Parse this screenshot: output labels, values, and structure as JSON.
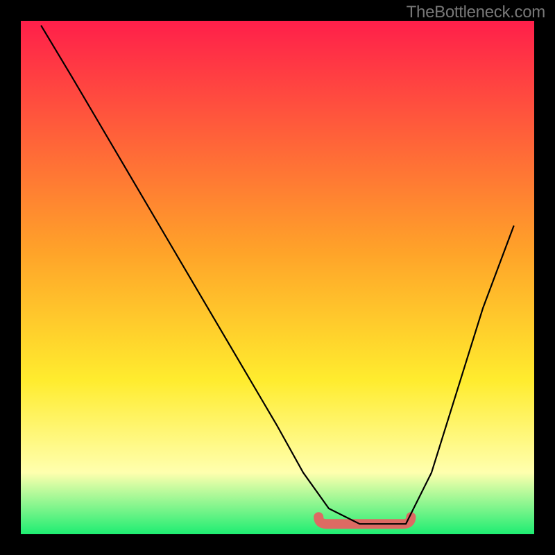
{
  "watermark": "TheBottleneck.com",
  "colors": {
    "red": "#ff1f4a",
    "orange": "#ffa329",
    "yellow": "#ffec2e",
    "paleyellow": "#ffffae",
    "green": "#1eed72",
    "basin": "#dd6a63",
    "border": "#000000"
  },
  "chart_data": {
    "type": "line",
    "title": "",
    "xlabel": "",
    "ylabel": "",
    "xlim": [
      0,
      100
    ],
    "ylim": [
      0,
      100
    ],
    "series": [
      {
        "name": "bottleneck-curve",
        "x": [
          4,
          10,
          20,
          30,
          40,
          50,
          55,
          60,
          66,
          70,
          75,
          80,
          85,
          90,
          96
        ],
        "y": [
          99,
          89,
          72,
          55,
          38,
          21,
          12,
          5,
          2,
          2,
          2,
          12,
          28,
          44,
          60
        ]
      }
    ],
    "annotations": [
      {
        "name": "optimal-basin",
        "x_range": [
          58,
          76
        ],
        "y": 2
      }
    ],
    "gradient_stops_y": [
      {
        "y": 100,
        "color": "#ff1f4a"
      },
      {
        "y": 55,
        "color": "#ffa329"
      },
      {
        "y": 30,
        "color": "#ffec2e"
      },
      {
        "y": 12,
        "color": "#ffffae"
      },
      {
        "y": 0,
        "color": "#1eed72"
      }
    ]
  }
}
